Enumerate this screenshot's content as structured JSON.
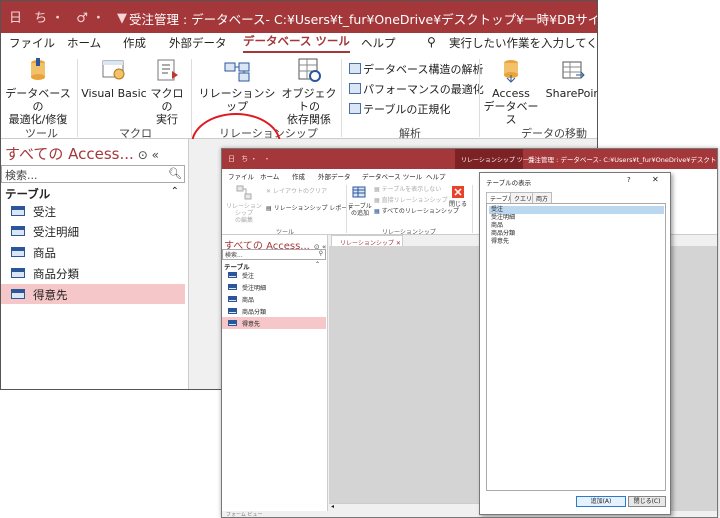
{
  "back": {
    "title": "受注管理 : データベース- C:¥Users¥t_fur¥OneDrive¥デスクトップ¥一時¥DBサイト作成用¥サンプルデー",
    "qat": "日 ち・ ♂・ ▼",
    "menu": [
      "ファイル",
      "ホーム",
      "作成",
      "外部データ",
      "データベース ツール",
      "ヘルプ"
    ],
    "tell_me": "実行したい作業を入力してくださ",
    "ribbon": {
      "compact_repair": "データベースの\n最適化/修復",
      "visual_basic": "Visual Basic",
      "macro_run": "マクロの\n実行",
      "relationships": "リレーションシップ",
      "object_deps": "オブジェクトの\n依存関係",
      "db_documenter": "データベース構造の解析",
      "perf_analyzer": "パフォーマンスの最適化",
      "table_analyzer": "テーブルの正規化",
      "access_db": "Access\nデータベース",
      "sharepoint": "SharePoin",
      "groups": {
        "tools": "ツール",
        "macro": "マクロ",
        "relationships": "リレーションシップ",
        "analyze": "解析",
        "move_data": "データの移動"
      }
    },
    "nav": {
      "header": "すべての Access...",
      "search_placeholder": "検索...",
      "section": "テーブル",
      "items": [
        "受注",
        "受注明細",
        "商品",
        "商品分類",
        "得意先"
      ],
      "selected": "得意先"
    }
  },
  "front": {
    "qat": "日 ち・ ・ ",
    "context_tab": "リレーションシップ ツール",
    "title": "受注管理 : データベース- C:¥Users¥t_fur¥OneDrive¥デスクトップ¥一時¥DB",
    "menu": [
      "ファイル",
      "ホーム",
      "作成",
      "外部データ",
      "データベース ツール",
      "ヘルプ"
    ],
    "ribbon": {
      "edit_rel": "リレーションシップ\nの編集",
      "clear_layout": "レイアウトのクリア",
      "rel_report": "リレーションシップ レポート",
      "add_table": "テーブル\nの追加",
      "hide_table": "テーブルを表示しない",
      "direct_rel": "直接リレーションシップ",
      "all_rel": "すべてのリレーションシップ",
      "close": "閉じる",
      "groups": {
        "tools": "ツール",
        "relationships": "リレーションシップ"
      }
    },
    "nav": {
      "header": "すべての Access...",
      "search_placeholder": "検索...",
      "section": "テーブル",
      "items": [
        "受注",
        "受注明細",
        "商品",
        "商品分類",
        "得意先"
      ],
      "selected": "得意先"
    },
    "doc_tab": "リレーションシップ",
    "status": "フォーム ビュー"
  },
  "dialog": {
    "title": "テーブルの表示",
    "help": "?",
    "close": "✕",
    "tabs": [
      "テーブル",
      "クエリ",
      "両方"
    ],
    "items": [
      "受注",
      "受注明細",
      "商品",
      "商品分類",
      "得意先"
    ],
    "selected": "受注",
    "add_button": "追加(A)",
    "close_button": "閉じる(C)"
  },
  "colors": {
    "access_red": "#a4373a",
    "highlight_oval": "#e0191f",
    "selection_pink": "#f6c7c8",
    "list_selection": "#bcd7f0"
  }
}
